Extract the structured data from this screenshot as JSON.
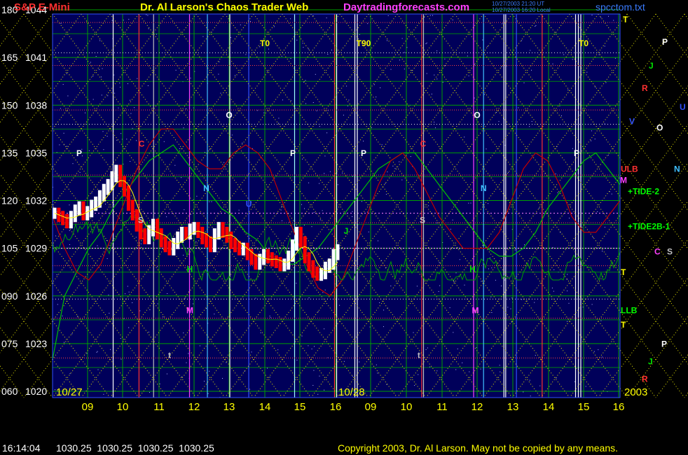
{
  "header": {
    "instrument": "S&P E-Mini",
    "title": "Dr. Al Larson's Chaos Trader Web",
    "site": "Daytradingforecasts.com",
    "timestamp_line1": "10/27/2003 21:20 UT",
    "timestamp_line2": "10/27/2003 16:20 Local",
    "filename": "spcctom.txt"
  },
  "footer": {
    "quote_time": "16:14:04",
    "quote_values": "1030.25  1030.25  1030.25  1030.25",
    "copyright": "Copyright 2003, Dr. Al Larson. May not be copied by any means."
  },
  "colors": {
    "background": "#00005a",
    "grid_green": "#00a000",
    "grid_yellow": "#e6e600",
    "price_up": "#ffffff",
    "price_down": "#ff0000",
    "header_red": "#ff3030",
    "header_yellow": "#ffff00",
    "header_magenta": "#ff40ff",
    "header_blue": "#3a7bff"
  },
  "chart_data": {
    "type": "line",
    "y_left_labels": [
      "180",
      "165",
      "150",
      "135",
      "120",
      "105",
      "090",
      "075",
      "060"
    ],
    "y_price_labels": [
      "1044",
      "1041",
      "1038",
      "1035",
      "1032",
      "1029",
      "1026",
      "1023",
      "1020"
    ],
    "ylim": [
      1020,
      1044
    ],
    "x_ticks": [
      "09",
      "10",
      "11",
      "12",
      "13",
      "14",
      "15",
      "16",
      "09",
      "10",
      "11",
      "12",
      "13",
      "14",
      "15",
      "16"
    ],
    "date_labels": [
      "10/27",
      "10/28"
    ],
    "year_label": "2003",
    "chart_markers": [
      {
        "text": "T0",
        "color": "#ffff00"
      },
      {
        "text": "T90",
        "color": "#ffff00"
      },
      {
        "text": "T0",
        "color": "#ffff00"
      },
      {
        "text": "P",
        "color": "#ffffff"
      },
      {
        "text": "P",
        "color": "#ffffff"
      },
      {
        "text": "P",
        "color": "#ffffff"
      },
      {
        "text": "P",
        "color": "#ffffff"
      },
      {
        "text": "O",
        "color": "#ffffff"
      },
      {
        "text": "O",
        "color": "#ffffff"
      },
      {
        "text": "C",
        "color": "#ff3030"
      },
      {
        "text": "C",
        "color": "#ff3030"
      },
      {
        "text": "N",
        "color": "#40c0ff"
      },
      {
        "text": "N",
        "color": "#40c0ff"
      },
      {
        "text": "S",
        "color": "#c0c0c0"
      },
      {
        "text": "S",
        "color": "#c0c0c0"
      },
      {
        "text": "H",
        "color": "#00e000"
      },
      {
        "text": "H",
        "color": "#00e000"
      },
      {
        "text": "M",
        "color": "#ff40ff"
      },
      {
        "text": "M",
        "color": "#ff40ff"
      },
      {
        "text": "J",
        "color": "#00e000"
      },
      {
        "text": "U",
        "color": "#3050ff"
      },
      {
        "text": "t",
        "color": "#c0c0c0"
      },
      {
        "text": "t",
        "color": "#c0c0c0"
      }
    ],
    "right_labels": [
      {
        "text": "T",
        "color": "#ffff00"
      },
      {
        "text": "P",
        "color": "#ffffff"
      },
      {
        "text": "J",
        "color": "#00e000"
      },
      {
        "text": "R",
        "color": "#ff3030"
      },
      {
        "text": "U",
        "color": "#3050ff"
      },
      {
        "text": "V",
        "color": "#3050ff"
      },
      {
        "text": "O",
        "color": "#ffffff"
      },
      {
        "text": "ULB",
        "color": "#ff3030"
      },
      {
        "text": "N",
        "color": "#40c0ff"
      },
      {
        "text": "M",
        "color": "#ff40ff"
      },
      {
        "text": "+TIDE-2",
        "color": "#00ff00"
      },
      {
        "text": "+TIDE2B-1",
        "color": "#00ff00"
      },
      {
        "text": "C",
        "color": "#ff40ff"
      },
      {
        "text": "S",
        "color": "#c0c0c0"
      },
      {
        "text": "T",
        "color": "#ffff00"
      },
      {
        "text": "LLB",
        "color": "#00ff00"
      },
      {
        "text": "T",
        "color": "#ffff00"
      },
      {
        "text": "P",
        "color": "#ffffff"
      },
      {
        "text": "J",
        "color": "#00e000"
      },
      {
        "text": "R",
        "color": "#ff3030"
      }
    ],
    "price_series": [
      1031.2,
      1031.0,
      1030.8,
      1030.6,
      1031.0,
      1031.4,
      1031.6,
      1031.1,
      1031.3,
      1031.7,
      1031.9,
      1032.3,
      1032.7,
      1033.0,
      1033.5,
      1033.9,
      1033.2,
      1032.6,
      1031.7,
      1031.1,
      1030.4,
      1029.9,
      1029.6,
      1030.1,
      1030.5,
      1029.9,
      1029.4,
      1029.1,
      1028.9,
      1029.3,
      1029.7,
      1030.0,
      1029.9,
      1030.2,
      1030.3,
      1030.0,
      1029.6,
      1029.4,
      1029.1,
      1029.9,
      1030.3,
      1030.0,
      1029.7,
      1029.3,
      1029.1,
      1028.9,
      1029.0,
      1028.6,
      1028.3,
      1028.0,
      1028.3,
      1028.6,
      1028.4,
      1028.2,
      1028.1,
      1027.9,
      1028.0,
      1028.5,
      1029.2,
      1030.0,
      1029.4,
      1028.4,
      1027.9,
      1027.5,
      1027.3,
      1027.4,
      1027.8,
      1028.0,
      1028.6,
      1028.9
    ],
    "series": [
      {
        "name": "TIDE-2",
        "color": "#00c000",
        "values": [
          1022,
          1026,
          1027.5,
          1029,
          1030,
          1031.5,
          1032.5,
          1033.5,
          1034.5,
          1035,
          1035.5,
          1034.5,
          1033.5,
          1032.5,
          1031.5,
          1031,
          1030,
          1029.5,
          1028.5,
          1028,
          1028,
          1028.5,
          1029,
          1030,
          1031,
          1032,
          1033,
          1034,
          1034.5,
          1035,
          1035,
          1034,
          1033,
          1032,
          1031,
          1030,
          1029,
          1028.5,
          1028.5,
          1029,
          1030,
          1031.5,
          1032.5,
          1033.5,
          1034.5,
          1035,
          1034,
          1033
        ]
      },
      {
        "name": "TIDE2B-1",
        "color": "#c00000",
        "values": [
          1031,
          1029,
          1027.5,
          1027,
          1028,
          1030,
          1032,
          1034,
          1035.5,
          1036.5,
          1036.5,
          1035.5,
          1034.5,
          1034,
          1034,
          1035,
          1035.5,
          1035,
          1034,
          1032,
          1030,
          1028,
          1026.5,
          1026,
          1027,
          1029,
          1031,
          1033,
          1034.5,
          1035,
          1034,
          1032.5,
          1031,
          1030,
          1029,
          1029,
          1029,
          1030,
          1032,
          1034,
          1035,
          1034.5,
          1033,
          1031,
          1030,
          1030,
          1031,
          1032
        ]
      }
    ]
  }
}
